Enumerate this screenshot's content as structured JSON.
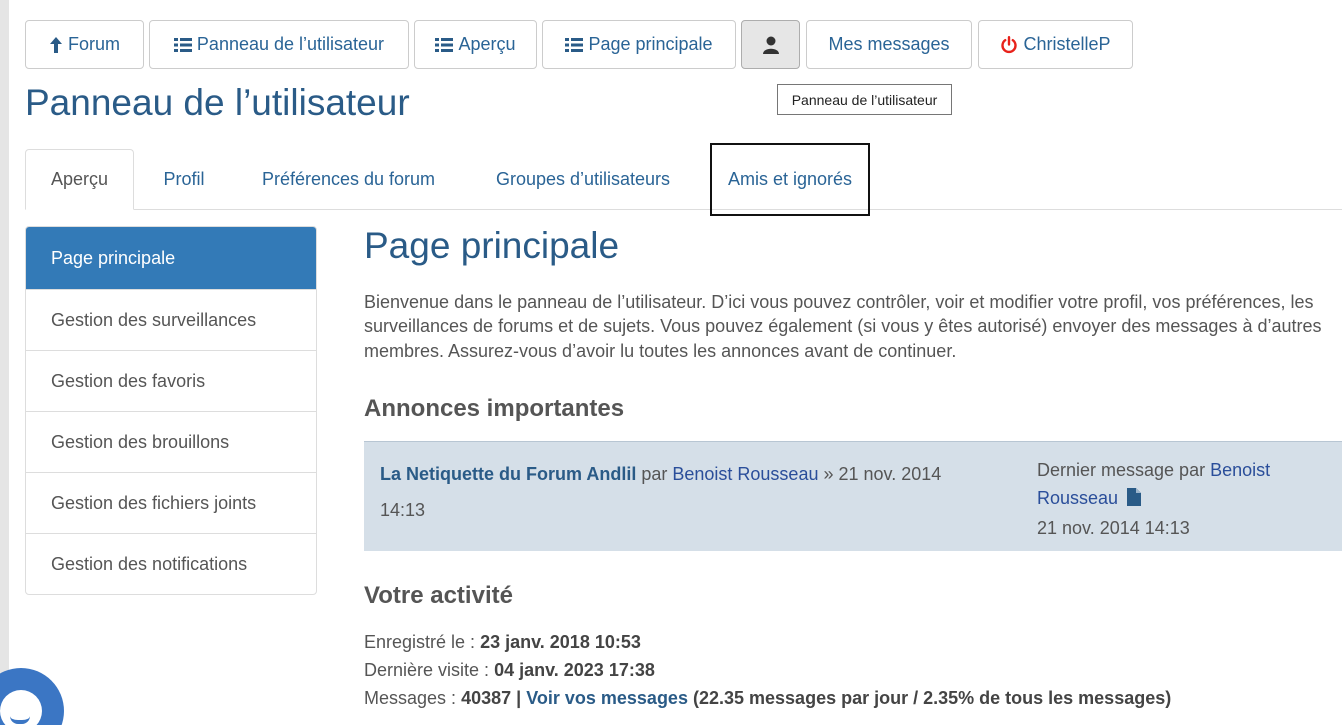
{
  "topnav": {
    "forum": "Forum",
    "user_panel": "Panneau de l’utilisateur",
    "overview": "Aperçu",
    "main_page": "Page principale",
    "messages": "Mes messages",
    "user": "ChristelleP"
  },
  "tooltip": "Panneau de l’utilisateur",
  "page_title": "Panneau de l’utilisateur",
  "tabs": [
    {
      "label": "Aperçu"
    },
    {
      "label": "Profil"
    },
    {
      "label": "Préférences du forum"
    },
    {
      "label": "Groupes d’utilisateurs"
    },
    {
      "label": "Amis et ignorés"
    }
  ],
  "sidebar": {
    "items": [
      {
        "label": "Page principale"
      },
      {
        "label": "Gestion des surveillances"
      },
      {
        "label": "Gestion des favoris"
      },
      {
        "label": "Gestion des brouillons"
      },
      {
        "label": "Gestion des fichiers joints"
      },
      {
        "label": "Gestion des notifications"
      }
    ]
  },
  "main": {
    "title": "Page principale",
    "intro": "Bienvenue dans le panneau de l’utilisateur. D’ici vous pouvez contrôler, voir et modifier votre profil, vos préférences, les surveillances de forums et de sujets. Vous pouvez également (si vous y êtes autorisé) envoyer des messages à d’autres membres. Assurez-vous d’avoir lu toutes les annonces avant de continuer.",
    "announcements_heading": "Annonces importantes",
    "announcement": {
      "title": "La Netiquette du Forum Andlil",
      "by": "par",
      "author": "Benoist Rousseau",
      "date": "» 21 nov. 2014 14:13",
      "last_prefix": "Dernier message par",
      "last_author": "Benoist Rousseau",
      "last_date": "21 nov. 2014 14:13"
    },
    "activity_heading": "Votre activité",
    "activity": {
      "registered_label": "Enregistré le :",
      "registered_value": "23 janv. 2018 10:53",
      "last_visit_label": "Dernière visite :",
      "last_visit_value": "04 janv. 2023 17:38",
      "messages_label": "Messages :",
      "messages_count": "40387",
      "separator": "|",
      "view_messages": "Voir vos messages",
      "messages_stats": "(22.35 messages par jour / 2.35% de tous les messages)"
    }
  },
  "colors": {
    "accent": "#337ab7",
    "heading": "#2a5b87",
    "link": "#2a4e9a",
    "announce_bg": "#d5dfe8",
    "power": "#e8221b"
  },
  "icons": {
    "forum": "arrow-up-icon",
    "list": "list-icon",
    "user": "user-icon",
    "power": "power-icon",
    "file": "file-icon"
  }
}
